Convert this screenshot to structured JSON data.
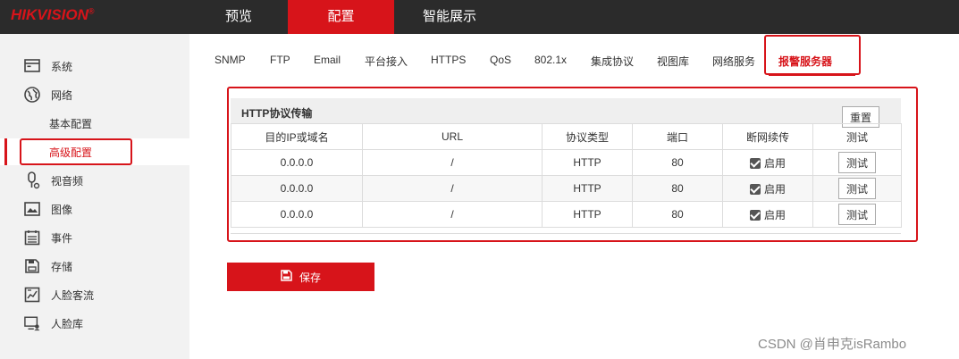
{
  "brand": {
    "name": "HIKVISION",
    "mark": "®"
  },
  "top_nav": [
    {
      "label": "预览"
    },
    {
      "label": "配置",
      "active": true
    },
    {
      "label": "智能展示"
    }
  ],
  "sidebar": {
    "items": [
      {
        "label": "系统",
        "icon": "monitor-icon"
      },
      {
        "label": "网络",
        "icon": "globe-icon"
      },
      {
        "label": "基本配置",
        "sub": true
      },
      {
        "label": "高级配置",
        "sub": true,
        "active": true
      },
      {
        "label": "视音频",
        "icon": "microphone-icon"
      },
      {
        "label": "图像",
        "icon": "image-icon"
      },
      {
        "label": "事件",
        "icon": "calendar-icon"
      },
      {
        "label": "存储",
        "icon": "save-icon"
      },
      {
        "label": "人脸客流",
        "icon": "face-flow-icon"
      },
      {
        "label": "人脸库",
        "icon": "face-library-icon"
      }
    ]
  },
  "tabs": [
    {
      "label": "SNMP"
    },
    {
      "label": "FTP"
    },
    {
      "label": "Email"
    },
    {
      "label": "平台接入"
    },
    {
      "label": "HTTPS"
    },
    {
      "label": "QoS"
    },
    {
      "label": "802.1x"
    },
    {
      "label": "集成协议"
    },
    {
      "label": "视图库"
    },
    {
      "label": "网络服务"
    },
    {
      "label": "报警服务器",
      "active": true
    }
  ],
  "panel": {
    "title": "HTTP协议传输",
    "reset_label": "重置",
    "columns": [
      "目的IP或域名",
      "URL",
      "协议类型",
      "端口",
      "断网续传",
      "测试"
    ],
    "rows": [
      {
        "ip": "0.0.0.0",
        "url": "/",
        "protocol": "HTTP",
        "port": "80",
        "resume_label": "启用",
        "resume_checked": true,
        "test_label": "测试"
      },
      {
        "ip": "0.0.0.0",
        "url": "/",
        "protocol": "HTTP",
        "port": "80",
        "resume_label": "启用",
        "resume_checked": true,
        "test_label": "测试"
      },
      {
        "ip": "0.0.0.0",
        "url": "/",
        "protocol": "HTTP",
        "port": "80",
        "resume_label": "启用",
        "resume_checked": true,
        "test_label": "测试"
      }
    ]
  },
  "save_label": "保存",
  "watermark": "CSDN @肖申克isRambo",
  "colors": {
    "accent": "#d7141a",
    "topbar": "#2b2b2b",
    "sidebar": "#f2f2f2"
  }
}
